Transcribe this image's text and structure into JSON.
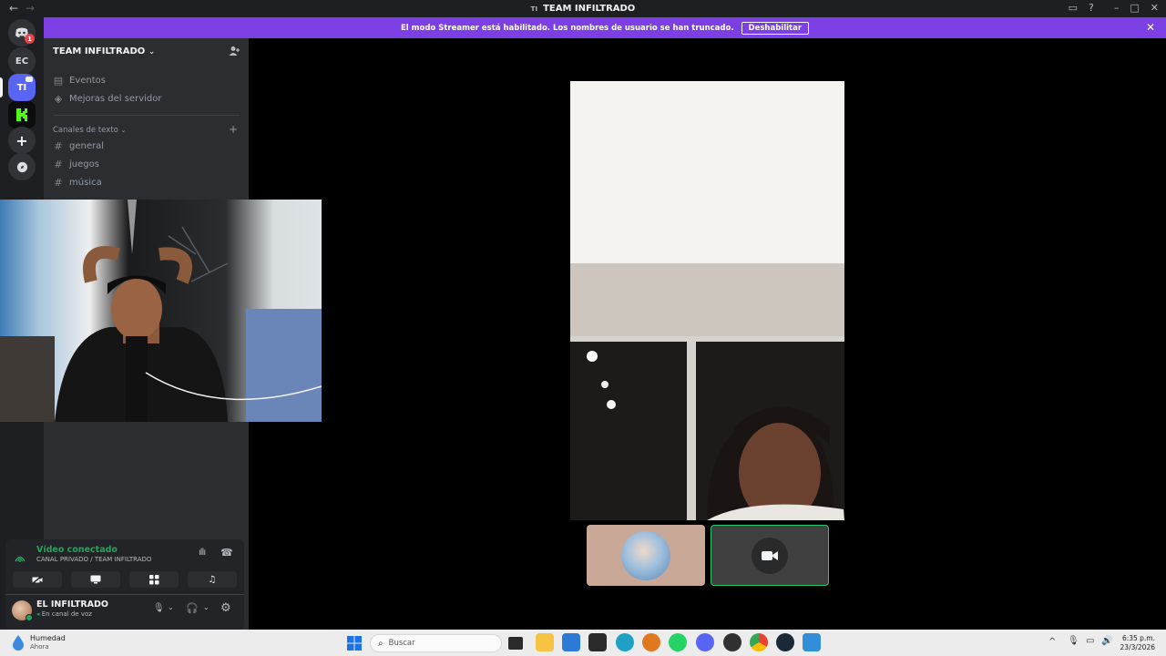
{
  "titlebar": {
    "back": "←",
    "forward": "→",
    "server_initials": "TI",
    "title": "TEAM INFILTRADO"
  },
  "banner": {
    "message": "El modo Streamer está habilitado. Los nombres de usuario se han truncado.",
    "button": "Deshabilitar"
  },
  "rail": {
    "badge": "1",
    "servers": [
      "EC",
      "TI"
    ]
  },
  "sidebar": {
    "server_name": "TEAM INFILTRADO",
    "items": [
      "Eventos",
      "Mejoras del servidor"
    ],
    "category": "Canales de texto",
    "channels": [
      "general",
      "juegos",
      "música"
    ]
  },
  "voice": {
    "status": "Vídeo conectado",
    "channel": "CANAL PRIVADO / TEAM INFILTRADO"
  },
  "user": {
    "name": "EL INFILTRADO",
    "status": "En canal de voz"
  },
  "taskbar": {
    "weather_title": "Humedad",
    "weather_sub": "Ahora",
    "search_placeholder": "Buscar",
    "time": "6:35 p.m.",
    "date": "23/3/2026"
  },
  "colors": {
    "accent": "#5865f2",
    "banner": "#7b3fe4",
    "voice_green": "#23a55a",
    "tile_border": "#2dc770"
  }
}
